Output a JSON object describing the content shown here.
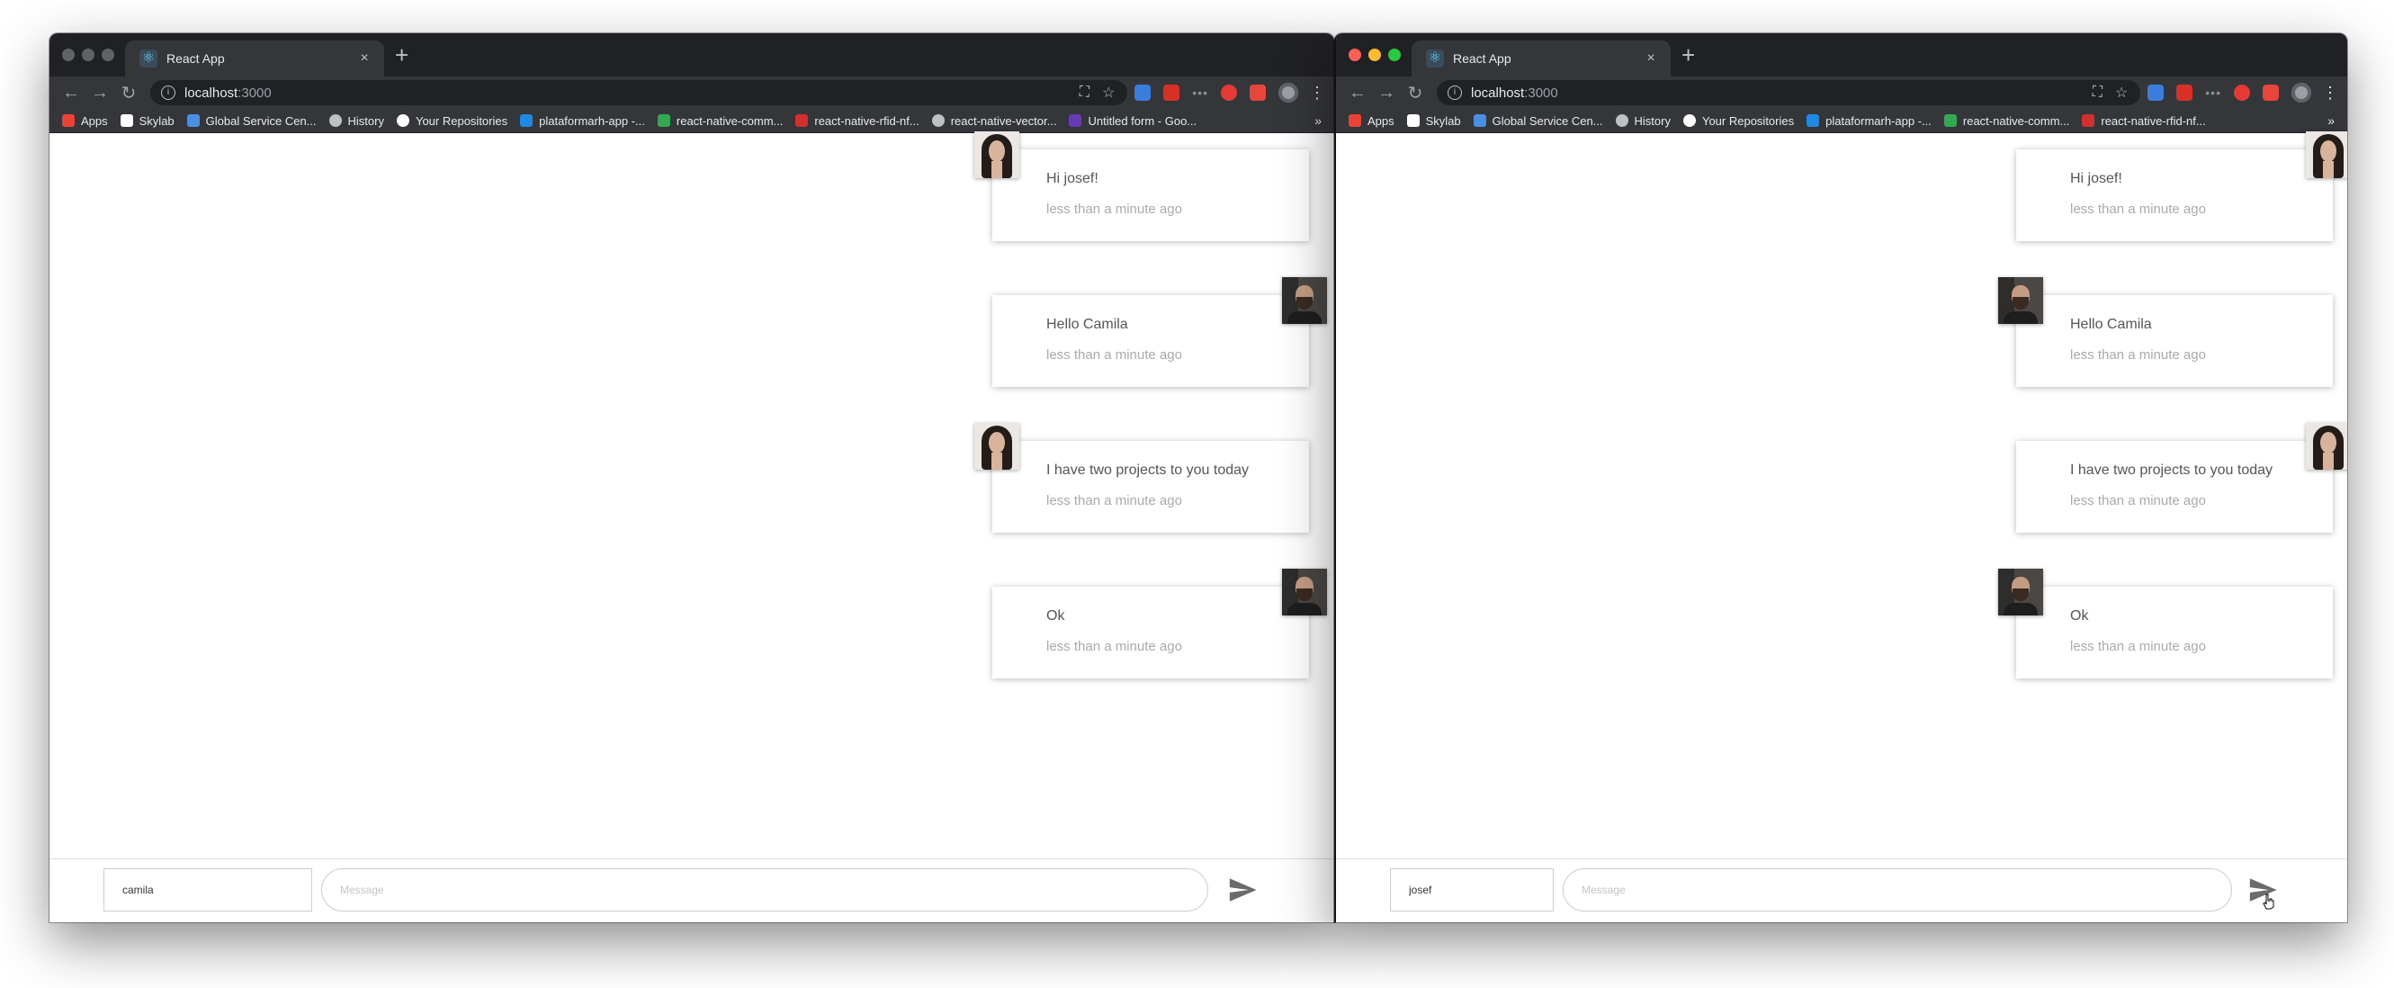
{
  "browser": {
    "tab_title": "React App",
    "tab_close": "×",
    "new_tab": "+",
    "url_host": "localhost",
    "url_port": ":3000",
    "bookmarks_more": "»"
  },
  "bookmarks_left": [
    "Apps",
    "Skylab",
    "Global Service Cen...",
    "History",
    "Your Repositories",
    "plataformarh-app -...",
    "react-native-comm...",
    "react-native-rfid-nf...",
    "react-native-vector...",
    "Untitled form - Goo..."
  ],
  "bookmarks_right": [
    "Apps",
    "Skylab",
    "Global Service Cen...",
    "History",
    "Your Repositories",
    "plataformarh-app -...",
    "react-native-comm...",
    "react-native-rfid-nf..."
  ],
  "messages": [
    {
      "text": "Hi josef!",
      "time": "less than a minute ago",
      "author": "camila"
    },
    {
      "text": "Hello Camila",
      "time": "less than a minute ago",
      "author": "josef"
    },
    {
      "text": "I have two projects to you today",
      "time": "less than a minute ago",
      "author": "camila"
    },
    {
      "text": "Ok",
      "time": "less than a minute ago",
      "author": "josef"
    }
  ],
  "left_window": {
    "name_value": "camila",
    "message_placeholder": "Message"
  },
  "right_window": {
    "name_value": "josef",
    "message_placeholder": "Message"
  },
  "colors": {
    "chrome_dark": "#202124",
    "chrome_toolbar": "#35363a",
    "send_icon": "#6b6b6b"
  }
}
